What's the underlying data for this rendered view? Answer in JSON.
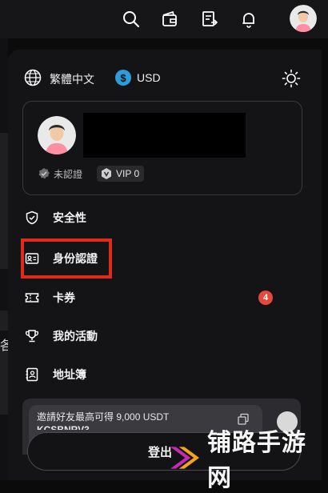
{
  "header": {
    "icons": [
      "search-icon",
      "wallet-icon",
      "orders-icon",
      "bell-icon",
      "avatar"
    ]
  },
  "background": {
    "partial_char": "各"
  },
  "settings": {
    "language": "繁體中文",
    "currency": "USD",
    "currency_symbol": "$",
    "theme_icon": "sun-icon"
  },
  "profile": {
    "verification_status": "未認證",
    "vip_level": "VIP 0"
  },
  "menu": {
    "items": [
      {
        "label": "安全性",
        "icon": "shield-icon"
      },
      {
        "label": "身份認證",
        "icon": "id-card-icon"
      },
      {
        "label": "卡券",
        "icon": "ticket-icon",
        "badge": "4"
      },
      {
        "label": "我的活動",
        "icon": "trophy-icon"
      },
      {
        "label": "地址簿",
        "icon": "address-book-icon"
      }
    ]
  },
  "invite": {
    "title": "邀請好友最高可得 9,000 USDT",
    "code": "KCSBNRV3"
  },
  "logout": {
    "label": "登出"
  },
  "watermark": {
    "text": "铺路手游网"
  },
  "colors": {
    "highlight": "#e02a1b",
    "badge": "#e5493d",
    "usd": "#2d9cdb"
  }
}
